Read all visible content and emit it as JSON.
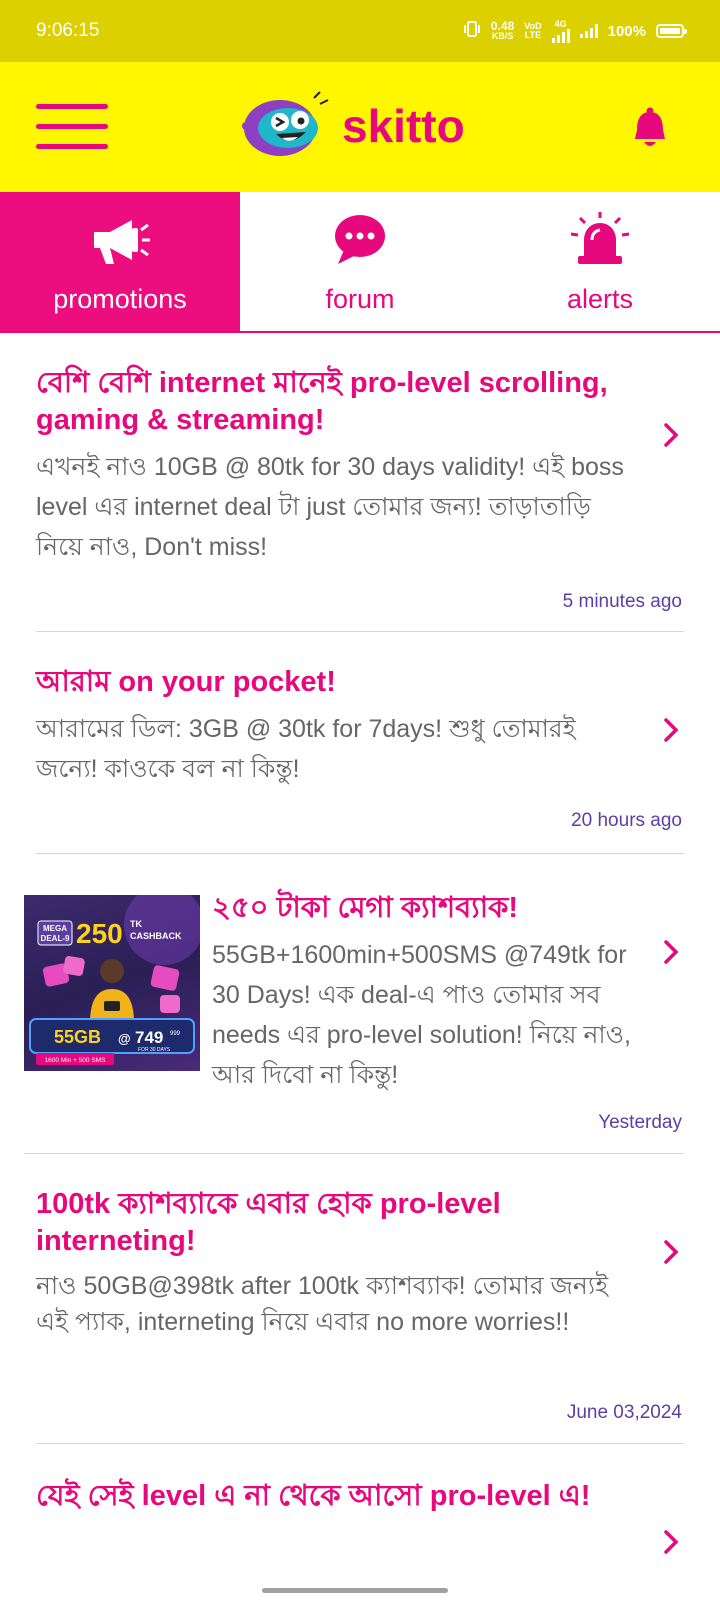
{
  "status_bar": {
    "time": "9:06:15",
    "net_speed_value": "0.48",
    "net_speed_unit": "KB/S",
    "volte_top": "VoD",
    "volte_bottom": "LTE",
    "network": "4G",
    "battery": "100%"
  },
  "header": {
    "brand_name": "skitto"
  },
  "tabs": [
    {
      "label": "promotions",
      "icon": "megaphone-icon",
      "active": true
    },
    {
      "label": "forum",
      "icon": "chat-bubble-icon",
      "active": false
    },
    {
      "label": "alerts",
      "icon": "siren-icon",
      "active": false
    }
  ],
  "promo_thumb": {
    "tag_line1": "MEGA",
    "tag_line2": "DEAL-9",
    "amount": "250",
    "amount_suffix": "TK",
    "cashback": "CASHBACK",
    "data": "55GB",
    "at": "@",
    "price": "749",
    "old_price": "999",
    "duration": "FOR 30 DAYS",
    "extras": "1600 Min + 500 SMS"
  },
  "feed": [
    {
      "title": "বেশি বেশি internet মানেই pro-level scrolling, gaming & streaming!",
      "body": "এখনই নাও 10GB @ 80tk for 30 days validity! এই boss level এর internet deal টা just তোমার জন্য! তাড়াতাড়ি নিয়ে নাও, Don't miss!",
      "time": "5 minutes ago"
    },
    {
      "title": "আরাম on your pocket!",
      "body": "আরামের ডিল: 3GB @ 30tk for 7days! শুধু তোমারই জন্যে! কাওকে বল না কিন্তু!",
      "time": "20 hours ago"
    },
    {
      "title": "২৫০ টাকা মেগা ক্যাশব্যাক!",
      "body": "55GB+1600min+500SMS @749tk for 30 Days! এক deal-এ পাও তোমার সব needs এর pro-level solution! নিয়ে নাও, আর দিবো না কিন্তু!",
      "time": "Yesterday"
    },
    {
      "title": "100tk ক্যাশব্যাকে এবার হোক pro-level interneting!",
      "body": "নাও 50GB@398tk after 100tk ক্যাশব্যাক! তোমার জন্যই এই প্যাক, interneting নিয়ে এবার no more worries!!",
      "time": "June 03,2024"
    },
    {
      "title": "যেই সেই level এ না থেকে আসো pro-level এ!",
      "body": "",
      "time": ""
    }
  ],
  "colors": {
    "brand_pink": "#e6087c",
    "header_yellow": "#fff700",
    "status_yellow": "#dcd000",
    "timestamp_purple": "#5b3fa6"
  }
}
